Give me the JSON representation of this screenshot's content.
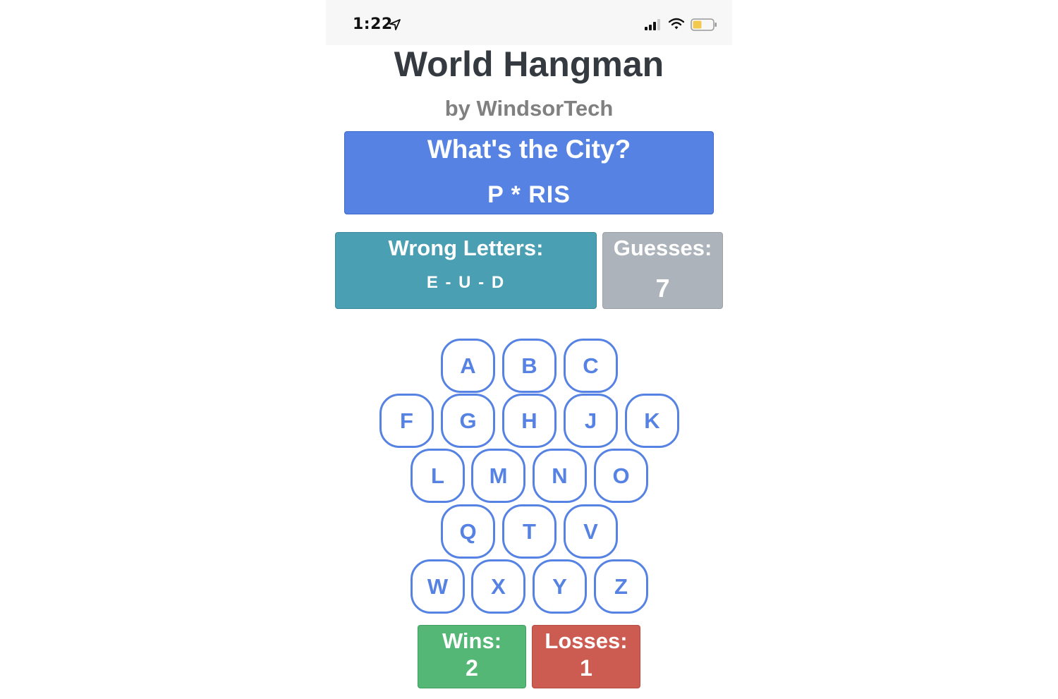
{
  "status_bar": {
    "time": "1:22",
    "icons": [
      "location-arrow-icon",
      "signal-icon",
      "wifi-icon",
      "battery-icon"
    ],
    "battery_color": "#f2c94c"
  },
  "header": {
    "title": "World Hangman",
    "byline": "by WindsorTech"
  },
  "puzzle": {
    "question": "What's the City?",
    "word": "P * RIS"
  },
  "wrong_letters": {
    "label": "Wrong Letters:",
    "value": "E - U - D"
  },
  "guesses": {
    "label": "Guesses:",
    "value": "7"
  },
  "keyboard": {
    "rows": [
      [
        "A",
        "B",
        "C"
      ],
      [
        "F",
        "G",
        "H",
        "J",
        "K"
      ],
      [
        "L",
        "M",
        "N",
        "O"
      ],
      [
        "Q",
        "T",
        "V"
      ],
      [
        "W",
        "X",
        "Y",
        "Z"
      ]
    ]
  },
  "stats": {
    "wins_label": "Wins:",
    "wins_value": "2",
    "losses_label": "Losses:",
    "losses_value": "1"
  },
  "colors": {
    "primary": "#5682e3",
    "info": "#4a9fb3",
    "secondary": "#adb3ba",
    "success": "#54b775",
    "danger": "#cc5c52"
  }
}
